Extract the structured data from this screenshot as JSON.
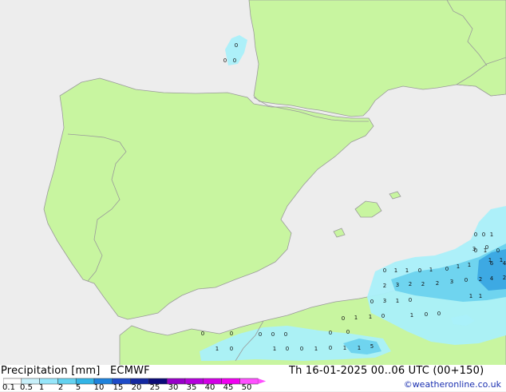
{
  "title": "Precipitation [mm]",
  "model": "ECMWF",
  "datetime": "Th 16-01-2025 00..06 UTC (00+150)",
  "credit": "©weatheronline.co.uk",
  "colors": {
    "sea": "#ededed",
    "land": "#c8f5a0",
    "border": "#9a9a9a",
    "light_precip": "#aaf0fa",
    "mid_precip": "#6cd2ee",
    "heavy_precip": "#3aa6e2"
  },
  "legend": {
    "labels": [
      "0.1",
      "0.5",
      "1",
      "2",
      "5",
      "10",
      "15",
      "20",
      "25",
      "30",
      "35",
      "40",
      "45",
      "50"
    ],
    "colors": [
      "#ffffff",
      "#c8f0fa",
      "#96e6fa",
      "#64d2f0",
      "#32b4e6",
      "#1e82dc",
      "#1e4bc8",
      "#1428a0",
      "#0a0a78",
      "#9600c8",
      "#b400dc",
      "#d200e6",
      "#f000f0",
      "#ff50ff"
    ]
  },
  "values": [
    {
      "v": "0"
    },
    {
      "v": "0"
    },
    {
      "v": "0"
    },
    {
      "v": "0"
    },
    {
      "v": "0"
    },
    {
      "v": "1"
    },
    {
      "v": "0"
    },
    {
      "v": "1"
    },
    {
      "v": "0"
    },
    {
      "v": "0"
    },
    {
      "v": "3"
    },
    {
      "v": "1"
    },
    {
      "v": "1"
    },
    {
      "v": "0"
    },
    {
      "v": "1"
    },
    {
      "v": "1"
    },
    {
      "v": "0"
    },
    {
      "v": "1"
    },
    {
      "v": "0"
    },
    {
      "v": "1"
    },
    {
      "v": "1"
    },
    {
      "v": "6"
    },
    {
      "v": "4"
    },
    {
      "v": "2"
    },
    {
      "v": "3"
    },
    {
      "v": "2"
    },
    {
      "v": "2"
    },
    {
      "v": "2"
    },
    {
      "v": "3"
    },
    {
      "v": "0"
    },
    {
      "v": "2"
    },
    {
      "v": "4"
    },
    {
      "v": "2"
    },
    {
      "v": "0"
    },
    {
      "v": "3"
    },
    {
      "v": "1"
    },
    {
      "v": "0"
    },
    {
      "v": "1"
    },
    {
      "v": "1"
    },
    {
      "v": "0"
    },
    {
      "v": "1"
    },
    {
      "v": "1"
    },
    {
      "v": "0"
    },
    {
      "v": "1"
    },
    {
      "v": "0"
    },
    {
      "v": "0"
    },
    {
      "v": "0"
    },
    {
      "v": "0"
    },
    {
      "v": "0"
    },
    {
      "v": "0"
    },
    {
      "v": "0"
    },
    {
      "v": "0"
    },
    {
      "v": "0"
    },
    {
      "v": "1"
    },
    {
      "v": "0"
    },
    {
      "v": "1"
    },
    {
      "v": "0"
    },
    {
      "v": "0"
    },
    {
      "v": "1"
    },
    {
      "v": "0"
    },
    {
      "v": "1"
    },
    {
      "v": "1"
    },
    {
      "v": "5"
    }
  ]
}
